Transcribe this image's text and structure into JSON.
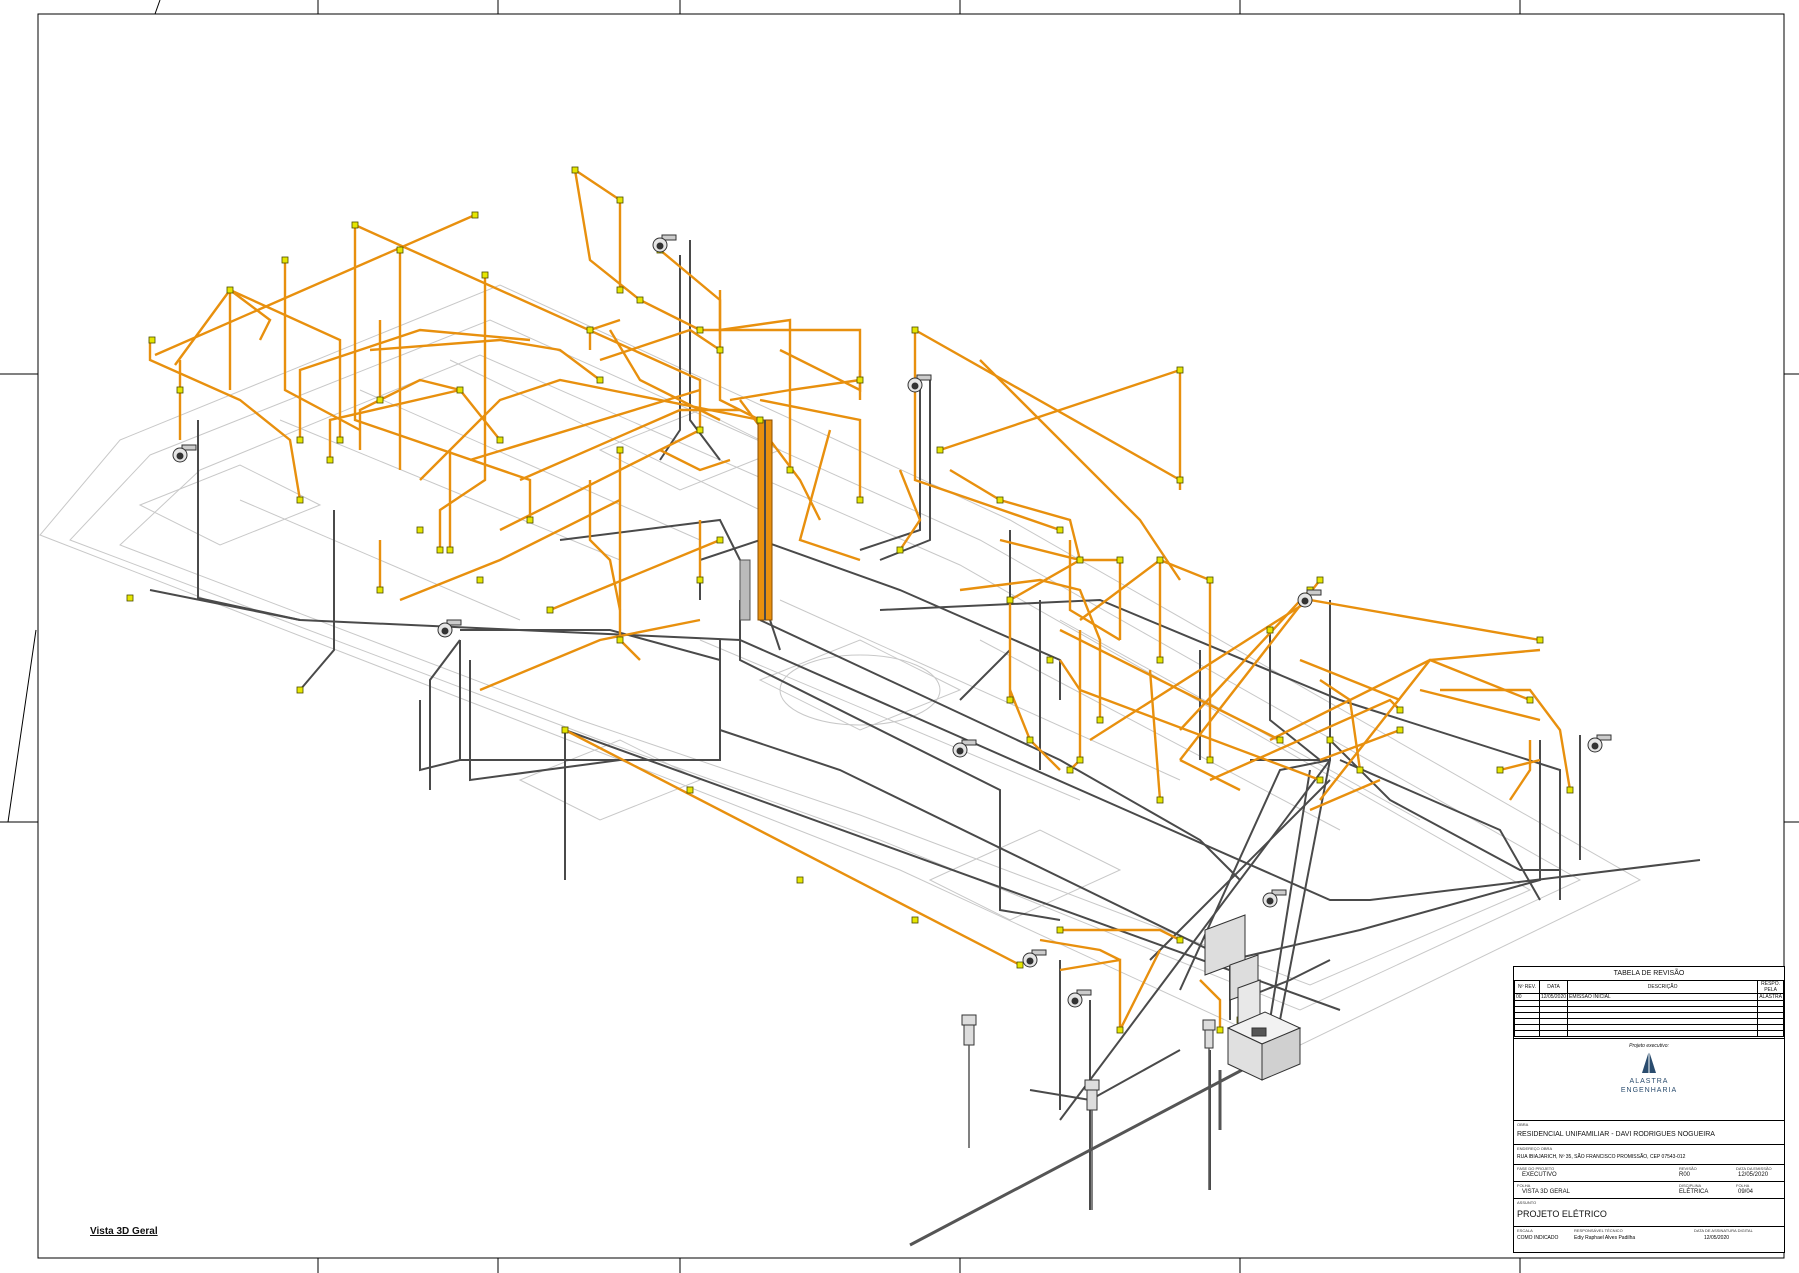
{
  "view_title": "Vista 3D Geral",
  "title_block": {
    "revision_table": {
      "title": "TABELA DE REVISÃO",
      "headers": [
        "Nº REV.",
        "DATA",
        "DESCRIÇÃO",
        "RESPO. PELA"
      ],
      "rows": [
        [
          "00",
          "12/05/2020",
          "EMISSÃO INICIAL",
          "ALASTRA"
        ]
      ]
    },
    "responsible_label": "Projeto executivo:",
    "company_name_1": "ALASTRA",
    "company_name_2": "ENGENHARIA",
    "work_label": "OBRA",
    "work_name": "RESIDENCIAL UNIFAMILIAR - DAVI RODRIGUES NOGUEIRA",
    "address_label": "ENDEREÇO OBRA",
    "address": "RUA IBIAJARICH, Nº 35, SÃO FRANCISCO PROMISSÃO, CEP 07543-012",
    "phase_label": "FASE DO PROJETO",
    "phase": "EXECUTIVO",
    "revision_label": "REVISÃO",
    "revision": "R00",
    "date_label": "DATA DA EMISSÃO",
    "date": "12/05/2020",
    "sheet_content_label": "FOLHA",
    "sheet_content": "VISTA 3D GERAL",
    "discipline_label": "DISCIPLINA",
    "discipline": "ELÉTRICA",
    "sheet_number_label": "FOLHA",
    "sheet_number": "09/04",
    "subject_label": "ASSUNTO",
    "subject": "PROJETO ELÉTRICO",
    "scale_label": "ESCALA",
    "scale": "COMO INDICADO",
    "designer_label": "RESPONSÁVEL TÉCNICO",
    "designer": "Ediy Raphael Alves Padilha",
    "signature_label": "DATA DE ASSINATURA DIGITAL",
    "signature": "12/05/2020"
  },
  "colors": {
    "conduit_orange": "#e8900e",
    "conduit_dark": "#4a4a4a",
    "fixture_yellow": "#e6e600",
    "floorplan_gray": "#c8c8c8",
    "logo_blue": "#2a4c6e"
  }
}
